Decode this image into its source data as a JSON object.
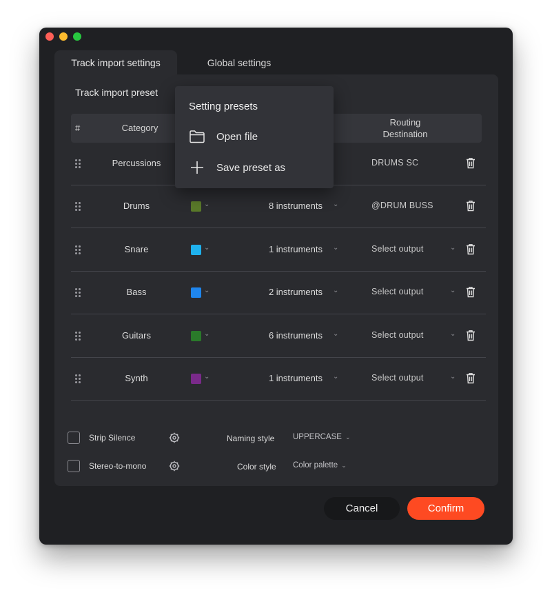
{
  "tabs": [
    {
      "label": "Track import settings",
      "active": true
    },
    {
      "label": "Global settings",
      "active": false
    }
  ],
  "preset": {
    "label": "Track import preset"
  },
  "table": {
    "headers": {
      "index": "#",
      "category": "Category",
      "routing": "Routing Destination"
    },
    "rows": [
      {
        "category": "Percussions",
        "color": "#3a3a3a",
        "instruments": "",
        "routing": "DRUMS SC"
      },
      {
        "category": "Drums",
        "color": "#5a7a2a",
        "instruments": "8 instruments",
        "routing": "@DRUM BUSS"
      },
      {
        "category": "Snare",
        "color": "#1fb2ee",
        "instruments": "1 instruments",
        "routing": "Select output"
      },
      {
        "category": "Bass",
        "color": "#1f86ee",
        "instruments": "2 instruments",
        "routing": "Select output"
      },
      {
        "category": "Guitars",
        "color": "#2a7a2a",
        "instruments": "6 instruments",
        "routing": "Select output"
      },
      {
        "category": "Synth",
        "color": "#7a2a8a",
        "instruments": "1 instruments",
        "routing": "Select output"
      }
    ]
  },
  "options": {
    "strip_silence": {
      "label": "Strip Silence",
      "checked": false
    },
    "stereo_to_mono": {
      "label": "Stereo-to-mono",
      "checked": false
    },
    "naming_style": {
      "label": "Naming style",
      "value": "UPPERCASE"
    },
    "color_style": {
      "label": "Color style",
      "value": "Color palette"
    }
  },
  "buttons": {
    "cancel": "Cancel",
    "confirm": "Confirm"
  },
  "popover": {
    "title": "Setting presets",
    "items": [
      {
        "label": "Open file",
        "icon": "folder-icon"
      },
      {
        "label": "Save preset as",
        "icon": "plus-icon"
      }
    ]
  },
  "colors": {
    "accent": "#fe4a22",
    "window": "#1f2023",
    "panel": "#2a2b2f"
  }
}
